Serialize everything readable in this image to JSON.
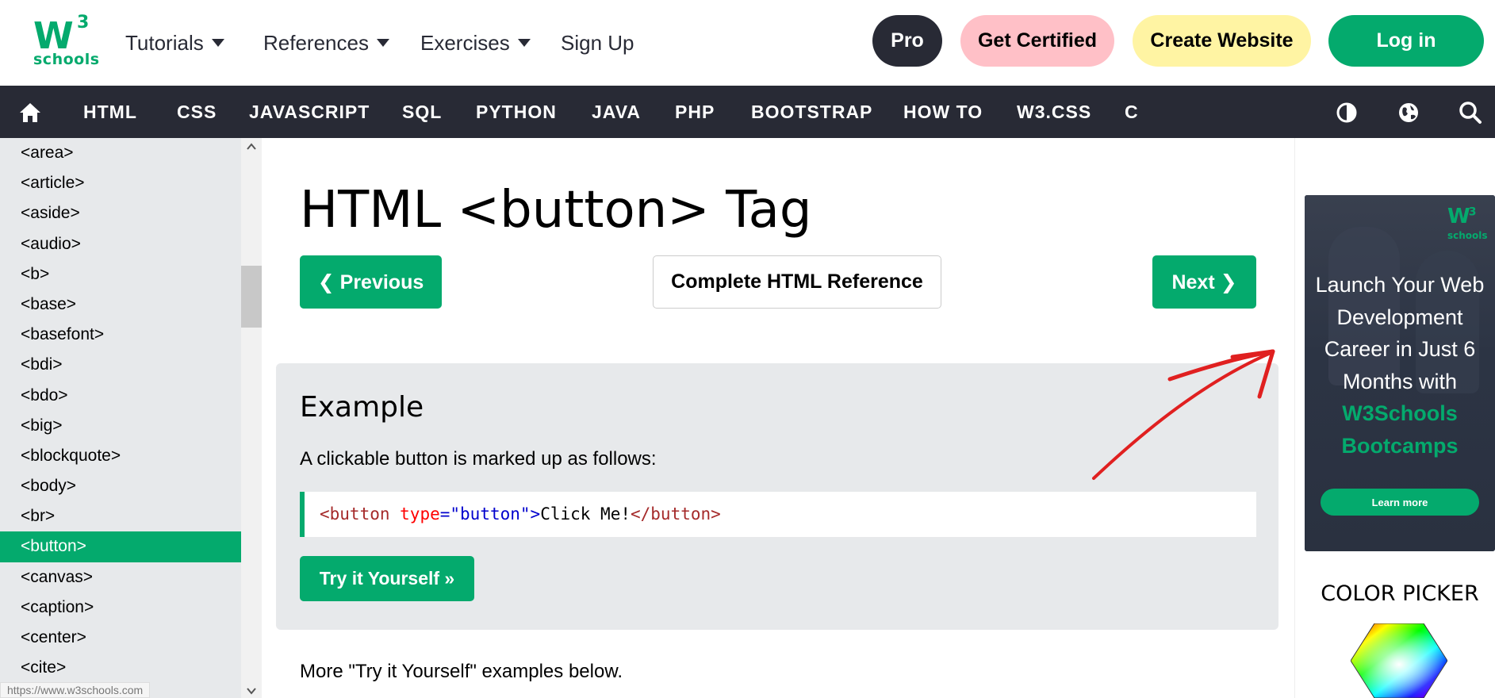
{
  "header": {
    "logo": {
      "brand": "W",
      "superscript": "3",
      "sub": "schools"
    },
    "nav": [
      {
        "label": "Tutorials",
        "dropdown": true
      },
      {
        "label": "References",
        "dropdown": true
      },
      {
        "label": "Exercises",
        "dropdown": true
      },
      {
        "label": "Sign Up",
        "dropdown": false
      }
    ],
    "buttons": {
      "pro": "Pro",
      "certified": "Get Certified",
      "create": "Create Website",
      "login": "Log in"
    }
  },
  "topnav": {
    "links": [
      "HTML",
      "CSS",
      "JAVASCRIPT",
      "SQL",
      "PYTHON",
      "JAVA",
      "PHP",
      "BOOTSTRAP",
      "HOW TO",
      "W3.CSS",
      "C"
    ],
    "icons": [
      "home-icon",
      "theme-contrast-icon",
      "globe-icon",
      "search-icon"
    ]
  },
  "sidebar": {
    "items": [
      "<area>",
      "<article>",
      "<aside>",
      "<audio>",
      "<b>",
      "<base>",
      "<basefont>",
      "<bdi>",
      "<bdo>",
      "<big>",
      "<blockquote>",
      "<body>",
      "<br>",
      "<button>",
      "<canvas>",
      "<caption>",
      "<center>",
      "<cite>"
    ],
    "active": "<button>",
    "status_url": "https://www.w3schools.com"
  },
  "main": {
    "title": "HTML <button> Tag",
    "prev_label": "❮ Previous",
    "ref_label": "Complete HTML Reference",
    "next_label": "Next ❯",
    "example": {
      "heading": "Example",
      "text": "A clickable button is marked up as follows:",
      "code": {
        "open_tag": "<button",
        "attr": " type",
        "eq": "=",
        "value": "\"button\"",
        "close_bracket": ">",
        "inner_text": "Click Me!",
        "end_tag": "</button>"
      },
      "try_label": "Try it Yourself »"
    },
    "more_text": "More \"Try it Yourself\" examples below."
  },
  "ad": {
    "logo_brand": "W",
    "logo_superscript": "3",
    "logo_sub": "schools",
    "lines": [
      "Launch Your Web",
      "Development",
      "Career in Just 6",
      "Months with"
    ],
    "highlight": [
      "W3Schools",
      "Bootcamps"
    ],
    "cta": "Learn more"
  },
  "color_picker": {
    "title": "COLOR PICKER"
  },
  "colors": {
    "brand_green": "#04AA6D",
    "nav_dark": "#282A35",
    "sidebar_bg": "#E7E9EB",
    "pro_bg": "#282A35",
    "certified_bg": "#FFC0C7",
    "create_bg": "#FFF4A3",
    "annotation_red": "#E02020"
  }
}
